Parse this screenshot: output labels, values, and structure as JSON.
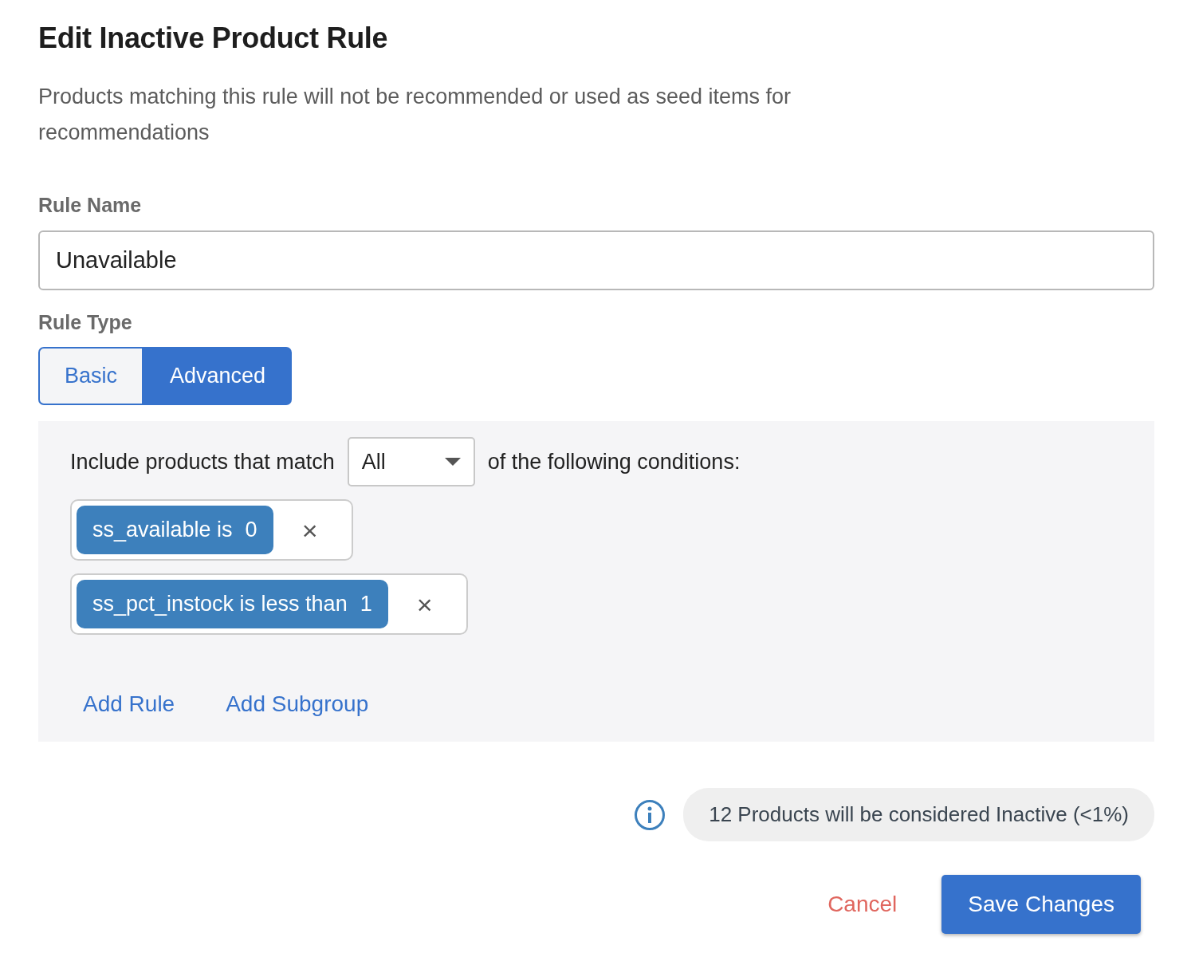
{
  "dialog": {
    "title": "Edit Inactive Product Rule",
    "description": "Products matching this rule will not be recommended or used as seed items for recommendations",
    "rule_name": {
      "label": "Rule Name",
      "value": "Unavailable"
    },
    "rule_type": {
      "label": "Rule Type",
      "options": [
        {
          "label": "Basic",
          "selected": false
        },
        {
          "label": "Advanced",
          "selected": true
        }
      ]
    },
    "conditions": {
      "prefix": "Include products that match",
      "match": "All",
      "suffix": "of the following conditions:",
      "rules": [
        {
          "condition": "ss_available is",
          "value": "0",
          "remove": "×"
        },
        {
          "condition": "ss_pct_instock is less than",
          "value": "1",
          "remove": "×"
        }
      ],
      "actions": [
        "Add Rule",
        "Add Subgroup"
      ]
    },
    "summary": "12 Products will be considered Inactive (<1%)",
    "buttons": {
      "cancel": "Cancel",
      "save": "Save Changes"
    }
  }
}
